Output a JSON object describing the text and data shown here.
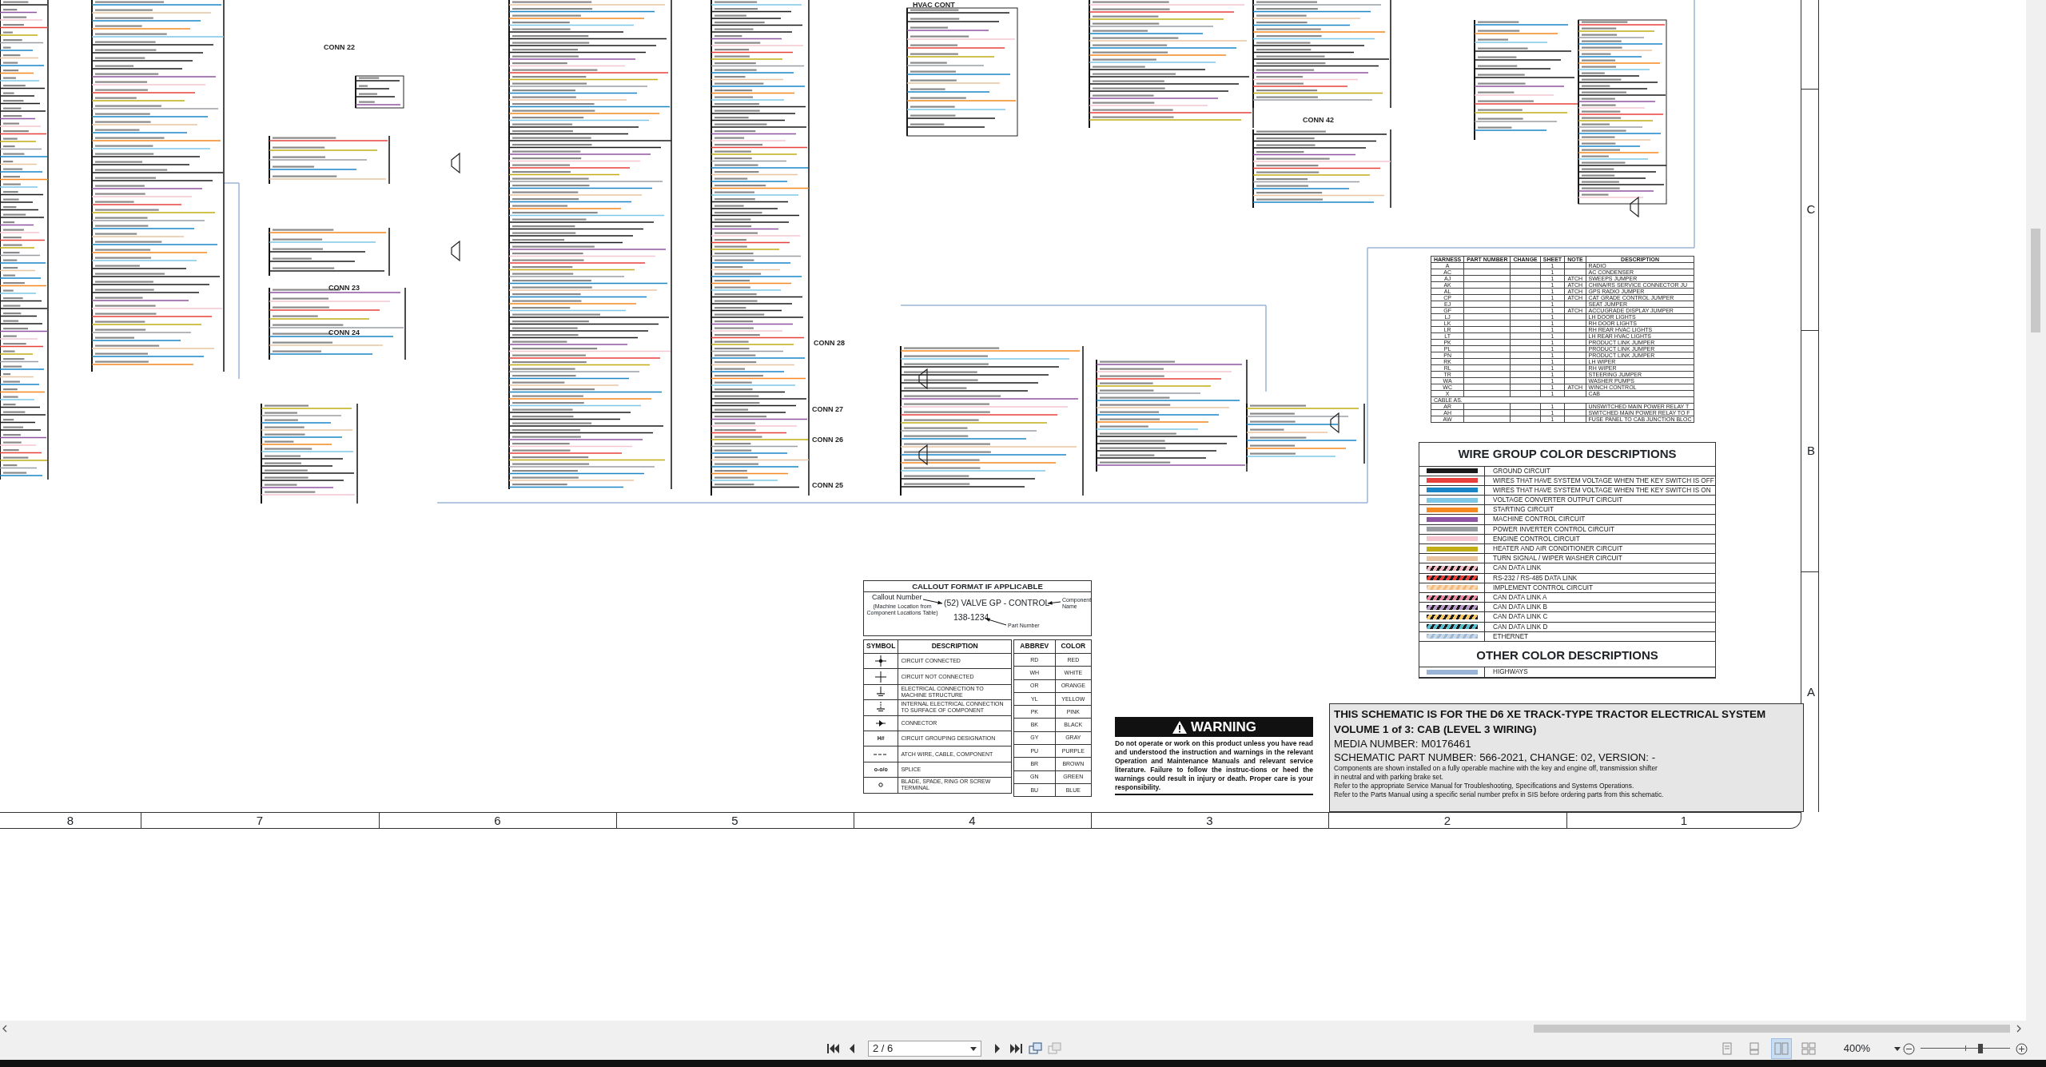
{
  "schematic": {
    "connector_labels": [
      "HVAC CONT",
      "CONN 22",
      "CONN 23",
      "CONN 24",
      "CONN 28",
      "CONN 27",
      "CONN 26",
      "CONN 25",
      "CONN 42"
    ],
    "harness_table": {
      "columns": [
        "HARNESS",
        "PART NUMBER",
        "CHANGE",
        "SHEET",
        "NOTE",
        "DESCRIPTION"
      ],
      "rows": [
        {
          "kind": "row",
          "harness": "A",
          "sheet": "1",
          "description": "RADIO"
        },
        {
          "kind": "row",
          "harness": "AC",
          "sheet": "1",
          "description": "AC CONDENSER"
        },
        {
          "kind": "row",
          "harness": "AJ",
          "sheet": "1",
          "note": "ATCH",
          "description": "SWEEPS JUMPER"
        },
        {
          "kind": "row",
          "harness": "AK",
          "sheet": "1",
          "note": "ATCH",
          "description": "CHINA/RS SERVICE CONNECTOR JU"
        },
        {
          "kind": "row",
          "harness": "AL",
          "sheet": "1",
          "note": "ATCH",
          "description": "GPS RADIO JUMPER"
        },
        {
          "kind": "row",
          "harness": "CP",
          "sheet": "1",
          "note": "ATCH",
          "description": "CAT GRADE CONTROL JUMPER"
        },
        {
          "kind": "row",
          "harness": "EJ",
          "sheet": "1",
          "description": "SEAT JUMPER"
        },
        {
          "kind": "row",
          "harness": "GF",
          "sheet": "1",
          "note": "ATCH",
          "description": "ACCUGRADE DISPLAY JUMPER"
        },
        {
          "kind": "row",
          "harness": "LJ",
          "sheet": "1",
          "description": "LH DOOR LIGHTS"
        },
        {
          "kind": "row",
          "harness": "LK",
          "sheet": "1",
          "description": "RH DOOR LIGHTS"
        },
        {
          "kind": "row",
          "harness": "LR",
          "sheet": "1",
          "description": "RH REAR HVAC LIGHTS"
        },
        {
          "kind": "row",
          "harness": "LT",
          "sheet": "1",
          "description": "LH REAR HVAC LIGHTS"
        },
        {
          "kind": "row",
          "harness": "PK",
          "sheet": "1",
          "description": "PRODUCT LINK JUMPER"
        },
        {
          "kind": "row",
          "harness": "PL",
          "sheet": "1",
          "description": "PRODUCT LINK JUMPER"
        },
        {
          "kind": "row",
          "harness": "PN",
          "sheet": "1",
          "description": "PRODUCT LINK JUMPER"
        },
        {
          "kind": "row",
          "harness": "RK",
          "sheet": "1",
          "description": "LH WIPER"
        },
        {
          "kind": "row",
          "harness": "RL",
          "sheet": "1",
          "description": "RH WIPER"
        },
        {
          "kind": "row",
          "harness": "TR",
          "sheet": "1",
          "description": "STEERING JUMPER"
        },
        {
          "kind": "row",
          "harness": "WA",
          "sheet": "1",
          "description": "WASHER PUMPS"
        },
        {
          "kind": "row",
          "harness": "WC",
          "sheet": "1",
          "note": "ATCH",
          "description": "WINCH CONTROL"
        },
        {
          "kind": "row",
          "harness": "X",
          "sheet": "1",
          "description": "CAB"
        },
        {
          "kind": "section",
          "harness": "CABLE AS."
        },
        {
          "kind": "row",
          "harness": "AR",
          "sheet": "1",
          "description": "UNSWITCHED MAIN POWER RELAY T"
        },
        {
          "kind": "row",
          "harness": "AH",
          "sheet": "1",
          "description": "SWITCHED MAIN POWER RELAY TO F"
        },
        {
          "kind": "row",
          "harness": "AW",
          "sheet": "1",
          "description": "FUSE PANEL TO CAB JUNCTION BLOC"
        }
      ]
    },
    "wire_legend": {
      "title": "WIRE GROUP COLOR DESCRIPTIONS",
      "items": [
        {
          "label": "GROUND CIRCUIT",
          "kind": "solid",
          "color": "#1a1a1a"
        },
        {
          "label": "WIRES THAT HAVE SYSTEM VOLTAGE WHEN THE KEY SWITCH IS OFF",
          "kind": "solid",
          "color": "#e8403a"
        },
        {
          "label": "WIRES THAT HAVE SYSTEM VOLTAGE WHEN THE KEY SWITCH IS ON",
          "kind": "solid",
          "color": "#1a86c8"
        },
        {
          "label": "VOLTAGE CONVERTER OUTPUT CIRCUIT",
          "kind": "solid",
          "color": "#7cc8e6"
        },
        {
          "label": "STARTING CIRCUIT",
          "kind": "solid",
          "color": "#f5891f"
        },
        {
          "label": "MACHINE CONTROL CIRCUIT",
          "kind": "solid",
          "color": "#9055a2"
        },
        {
          "label": "POWER INVERTER CONTROL CIRCUIT",
          "kind": "solid",
          "color": "#9a9ea3"
        },
        {
          "label": "ENGINE CONTROL CIRCUIT",
          "kind": "solid",
          "color": "#f5c6cf"
        },
        {
          "label": "HEATER AND AIR CONDITIONER CIRCUIT",
          "kind": "solid",
          "color": "#c2ad14"
        },
        {
          "label": "TURN SIGNAL / WIPER WASHER CIRCUIT",
          "kind": "solid",
          "color": "#e8c4a0"
        },
        {
          "label": "CAN DATA LINK",
          "kind": "striped",
          "color": "#f0b8c0"
        },
        {
          "label": "RS-232 / RS-485 DATA LINK",
          "kind": "striped",
          "color": "#e8403a"
        },
        {
          "label": "IMPLEMENT CONTROL CIRCUIT",
          "kind": "striped-light",
          "color": "#f4b878"
        },
        {
          "label": "CAN DATA LINK A",
          "kind": "striped",
          "color": "#e88aa0"
        },
        {
          "label": "CAN DATA LINK B",
          "kind": "striped",
          "color": "#b89ac8"
        },
        {
          "label": "CAN DATA LINK C",
          "kind": "striped",
          "color": "#f5c96b"
        },
        {
          "label": "CAN DATA LINK D",
          "kind": "striped",
          "color": "#5cc0d0"
        },
        {
          "label": "ETHERNET",
          "kind": "striped-light",
          "color": "#9fb8d4"
        }
      ],
      "other_title": "OTHER COLOR DESCRIPTIONS",
      "other_items": [
        {
          "label": "HIGHWAYS",
          "kind": "solid",
          "color": "#9ab4d8"
        }
      ]
    },
    "callout": {
      "title": "CALLOUT FORMAT IF APPLICABLE",
      "callout_number": "Callout Number",
      "callout_note": "(Machine Location from Component Locations Table)",
      "example": "(52) VALVE GP - CONTROL",
      "part": "138-1234",
      "component_name": "Component Name",
      "part_label": "Part Number"
    },
    "symbol_table": {
      "columns": [
        "SYMBOL",
        "DESCRIPTION"
      ],
      "rows": [
        {
          "kind": "connected",
          "description": "CIRCUIT CONNECTED"
        },
        {
          "kind": "not-connected",
          "description": "CIRCUIT NOT CONNECTED"
        },
        {
          "kind": "ground",
          "description": "ELECTRICAL CONNECTION TO MACHINE STRUCTURE"
        },
        {
          "kind": "internal-ground",
          "description": "INTERNAL ELECTRICAL CONNECTION TO SURFACE OF COMPONENT"
        },
        {
          "kind": "connector",
          "description": "CONNECTOR"
        },
        {
          "kind": "text",
          "symbol_text": "H#",
          "description": "CIRCUIT GROUPING DESIGNATION"
        },
        {
          "kind": "dashed",
          "description": "ATCH WIRE, CABLE, COMPONENT"
        },
        {
          "kind": "text",
          "symbol_text": "o-o/o",
          "description": "SPLICE"
        },
        {
          "kind": "terminal",
          "description": "BLADE, SPADE, RING OR SCREW TERMINAL"
        }
      ]
    },
    "abbrev_table": {
      "columns": [
        "ABBREV",
        "COLOR"
      ],
      "rows": [
        {
          "abbrev": "RD",
          "color_name": "RED"
        },
        {
          "abbrev": "WH",
          "color_name": "WHITE"
        },
        {
          "abbrev": "OR",
          "color_name": "ORANGE"
        },
        {
          "abbrev": "YL",
          "color_name": "YELLOW"
        },
        {
          "abbrev": "PK",
          "color_name": "PINK"
        },
        {
          "abbrev": "BK",
          "color_name": "BLACK"
        },
        {
          "abbrev": "GY",
          "color_name": "GRAY"
        },
        {
          "abbrev": "PU",
          "color_name": "PURPLE"
        },
        {
          "abbrev": "BR",
          "color_name": "BROWN"
        },
        {
          "abbrev": "GN",
          "color_name": "GREEN"
        },
        {
          "abbrev": "BU",
          "color_name": "BLUE"
        }
      ]
    },
    "warning": {
      "title": "WARNING",
      "text": "Do not operate or work on this product unless you have read and understood the instruction and warnings in the relevant Operation and Maintenance Manuals and relevant service literature. Failure to follow the instruc-tions or heed the warnings could result in injury or death. Proper care is your responsibility."
    },
    "title_block": {
      "heading": [
        "THIS SCHEMATIC IS FOR THE D6 XE TRACK-TYPE TRACTOR ELECTRICAL SYSTEM",
        "VOLUME 1 of 3: CAB (LEVEL 3 WIRING)"
      ],
      "info": [
        "MEDIA NUMBER: M0176461",
        "SCHEMATIC PART NUMBER: 566-2021, CHANGE: 02, VERSION: -"
      ],
      "notes": [
        "Components are shown installed on a fully operable machine with the key and engine off, transmission shifter",
        "in neutral and with parking brake set.",
        "Refer to the appropriate Service Manual for Troubleshooting, Specifications and Systems Operations.",
        "Refer to the Parts Manual using a specific serial number prefix in SIS before ordering parts from this schematic."
      ]
    },
    "zone_columns": [
      "8",
      "7",
      "6",
      "5",
      "4",
      "3",
      "2",
      "1"
    ],
    "zone_rows": [
      "C",
      "B",
      "A"
    ]
  },
  "viewer": {
    "page_field": "2 / 6",
    "tools": [
      {
        "disabled": false
      },
      {
        "disabled": true
      }
    ],
    "view_modes": [
      {
        "selected": false
      },
      {
        "selected": false
      },
      {
        "selected": true
      },
      {
        "selected": false
      }
    ],
    "zoom": "400%",
    "zoom_slider": {
      "level": 0.68
    }
  }
}
